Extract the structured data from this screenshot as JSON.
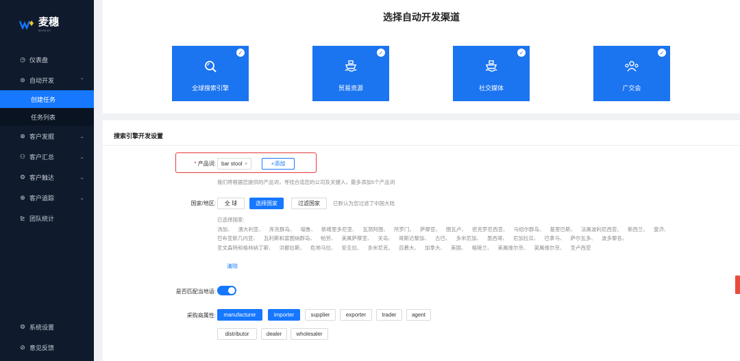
{
  "brand": {
    "name": "麦穗",
    "sub": "WHEAT"
  },
  "sidebar": {
    "items": [
      {
        "label": "仪表盘",
        "icon": "dashboard-icon",
        "glyph": "◷"
      },
      {
        "label": "自动开发",
        "icon": "auto-dev-icon",
        "glyph": "⊜",
        "expanded": true
      },
      {
        "label": "客户发掘",
        "icon": "customer-discover-icon",
        "glyph": "⊗"
      },
      {
        "label": "客户汇总",
        "icon": "customer-summary-icon",
        "glyph": "⚇"
      },
      {
        "label": "客户触达",
        "icon": "customer-reach-icon",
        "glyph": "⚙"
      },
      {
        "label": "客户追踪",
        "icon": "customer-track-icon",
        "glyph": "⊕"
      },
      {
        "label": "团队统计",
        "icon": "team-stats-icon",
        "glyph": "⊵"
      }
    ],
    "sub_items": [
      {
        "label": "创建任务",
        "active": true
      },
      {
        "label": "任务列表",
        "active": false
      }
    ],
    "bottom": [
      {
        "label": "系统设置",
        "icon": "settings-icon",
        "glyph": "⚙"
      },
      {
        "label": "意见反馈",
        "icon": "feedback-icon",
        "glyph": "⊘"
      }
    ]
  },
  "channels": {
    "title": "选择自动开发渠道",
    "cards": [
      {
        "label": "全球搜索引擎",
        "icon": "search-engine-icon",
        "selected": true
      },
      {
        "label": "贸易资源",
        "icon": "ship-icon",
        "selected": true
      },
      {
        "label": "社交媒体",
        "icon": "ship-icon",
        "selected": true
      },
      {
        "label": "广交会",
        "icon": "people-icon",
        "selected": true
      }
    ]
  },
  "settings": {
    "title": "搜索引擎开发设置",
    "product": {
      "label": "产品词:",
      "tags": [
        "bar stool"
      ],
      "add_label": "+添加",
      "hint": "我们将根据您提供的产品词，寻找合适您的公司及关键人，最多添加5个产品词"
    },
    "region": {
      "label": "国家/地区:",
      "options": [
        {
          "label": "全 球",
          "active": false
        },
        {
          "label": "选择国家",
          "active": true
        },
        {
          "label": "过滤国家",
          "active": false
        }
      ],
      "default_note": "已默认为您过滤了中国大陆",
      "selected_label": "已选择国家:",
      "countries_line1": [
        "汤加、",
        "澳大利亚、",
        "库克群岛、",
        "瑙鲁、",
        "新喀里多尼亚、",
        "瓦努阿图、",
        "所罗门、",
        "萨摩亚、",
        "图瓦卢、",
        "密克罗尼西亚、",
        "马绍尔群岛、",
        "基里巴斯、",
        "法属波利尼西亚、",
        "新西兰、",
        "斐济、"
      ],
      "countries_line2": [
        "巴布亚新几内亚、",
        "瓦利斯和富图纳群岛、",
        "帕劳、",
        "美属萨摩亚、",
        "关岛、",
        "哥斯达黎加、",
        "古巴、",
        "多米尼加、",
        "墨西哥、",
        "尼加拉瓜、",
        "巴拿马、",
        "萨尔瓦多、",
        "波多黎各、"
      ],
      "countries_line3": [
        "圣文森特和格林纳丁斯、",
        "洪都拉斯、",
        "危地马拉、",
        "安圭拉、",
        "多米尼克、",
        "百慕大、",
        "加拿大、",
        "美国、",
        "格陵兰、",
        "美属维尔京、",
        "英属维尔京、",
        "圣卢西亚"
      ],
      "clear_label": "清除"
    },
    "local_lang": {
      "label": "是否匹配当地语:",
      "on": true
    },
    "buyer_attr": {
      "label": "采购商属性:",
      "row1": [
        {
          "label": "manufacturer",
          "active": true
        },
        {
          "label": "importer",
          "active": true
        },
        {
          "label": "supplier",
          "active": false
        },
        {
          "label": "exporter",
          "active": false
        },
        {
          "label": "trader",
          "active": false
        },
        {
          "label": "agent",
          "active": false
        }
      ],
      "row2": [
        {
          "label": "distributor",
          "active": false
        },
        {
          "label": "dealer",
          "active": false
        },
        {
          "label": "wholesaler",
          "active": false
        }
      ]
    }
  },
  "colors": {
    "sidebar": "#0f1b2d",
    "accent": "#1677ff",
    "card": "#1b74f0",
    "highlight": "#e53935"
  }
}
